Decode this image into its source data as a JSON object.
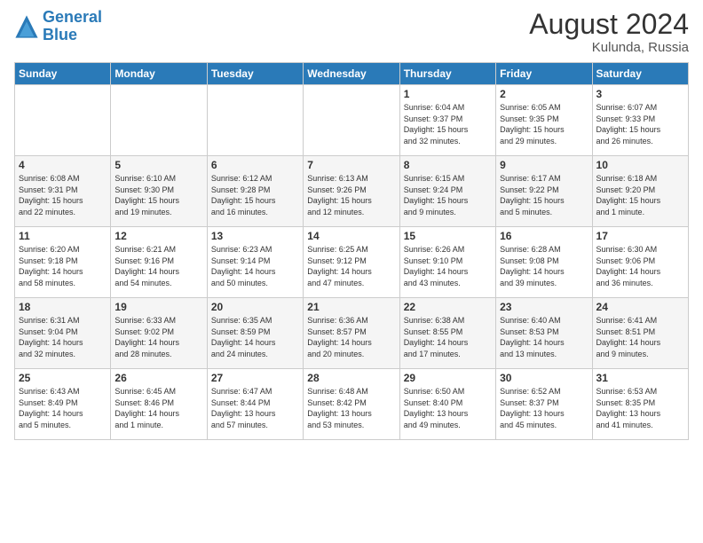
{
  "logo": {
    "line1": "General",
    "line2": "Blue"
  },
  "title": "August 2024",
  "subtitle": "Kulunda, Russia",
  "days_header": [
    "Sunday",
    "Monday",
    "Tuesday",
    "Wednesday",
    "Thursday",
    "Friday",
    "Saturday"
  ],
  "weeks": [
    [
      {
        "day": "",
        "info": ""
      },
      {
        "day": "",
        "info": ""
      },
      {
        "day": "",
        "info": ""
      },
      {
        "day": "",
        "info": ""
      },
      {
        "day": "1",
        "info": "Sunrise: 6:04 AM\nSunset: 9:37 PM\nDaylight: 15 hours\nand 32 minutes."
      },
      {
        "day": "2",
        "info": "Sunrise: 6:05 AM\nSunset: 9:35 PM\nDaylight: 15 hours\nand 29 minutes."
      },
      {
        "day": "3",
        "info": "Sunrise: 6:07 AM\nSunset: 9:33 PM\nDaylight: 15 hours\nand 26 minutes."
      }
    ],
    [
      {
        "day": "4",
        "info": "Sunrise: 6:08 AM\nSunset: 9:31 PM\nDaylight: 15 hours\nand 22 minutes."
      },
      {
        "day": "5",
        "info": "Sunrise: 6:10 AM\nSunset: 9:30 PM\nDaylight: 15 hours\nand 19 minutes."
      },
      {
        "day": "6",
        "info": "Sunrise: 6:12 AM\nSunset: 9:28 PM\nDaylight: 15 hours\nand 16 minutes."
      },
      {
        "day": "7",
        "info": "Sunrise: 6:13 AM\nSunset: 9:26 PM\nDaylight: 15 hours\nand 12 minutes."
      },
      {
        "day": "8",
        "info": "Sunrise: 6:15 AM\nSunset: 9:24 PM\nDaylight: 15 hours\nand 9 minutes."
      },
      {
        "day": "9",
        "info": "Sunrise: 6:17 AM\nSunset: 9:22 PM\nDaylight: 15 hours\nand 5 minutes."
      },
      {
        "day": "10",
        "info": "Sunrise: 6:18 AM\nSunset: 9:20 PM\nDaylight: 15 hours\nand 1 minute."
      }
    ],
    [
      {
        "day": "11",
        "info": "Sunrise: 6:20 AM\nSunset: 9:18 PM\nDaylight: 14 hours\nand 58 minutes."
      },
      {
        "day": "12",
        "info": "Sunrise: 6:21 AM\nSunset: 9:16 PM\nDaylight: 14 hours\nand 54 minutes."
      },
      {
        "day": "13",
        "info": "Sunrise: 6:23 AM\nSunset: 9:14 PM\nDaylight: 14 hours\nand 50 minutes."
      },
      {
        "day": "14",
        "info": "Sunrise: 6:25 AM\nSunset: 9:12 PM\nDaylight: 14 hours\nand 47 minutes."
      },
      {
        "day": "15",
        "info": "Sunrise: 6:26 AM\nSunset: 9:10 PM\nDaylight: 14 hours\nand 43 minutes."
      },
      {
        "day": "16",
        "info": "Sunrise: 6:28 AM\nSunset: 9:08 PM\nDaylight: 14 hours\nand 39 minutes."
      },
      {
        "day": "17",
        "info": "Sunrise: 6:30 AM\nSunset: 9:06 PM\nDaylight: 14 hours\nand 36 minutes."
      }
    ],
    [
      {
        "day": "18",
        "info": "Sunrise: 6:31 AM\nSunset: 9:04 PM\nDaylight: 14 hours\nand 32 minutes."
      },
      {
        "day": "19",
        "info": "Sunrise: 6:33 AM\nSunset: 9:02 PM\nDaylight: 14 hours\nand 28 minutes."
      },
      {
        "day": "20",
        "info": "Sunrise: 6:35 AM\nSunset: 8:59 PM\nDaylight: 14 hours\nand 24 minutes."
      },
      {
        "day": "21",
        "info": "Sunrise: 6:36 AM\nSunset: 8:57 PM\nDaylight: 14 hours\nand 20 minutes."
      },
      {
        "day": "22",
        "info": "Sunrise: 6:38 AM\nSunset: 8:55 PM\nDaylight: 14 hours\nand 17 minutes."
      },
      {
        "day": "23",
        "info": "Sunrise: 6:40 AM\nSunset: 8:53 PM\nDaylight: 14 hours\nand 13 minutes."
      },
      {
        "day": "24",
        "info": "Sunrise: 6:41 AM\nSunset: 8:51 PM\nDaylight: 14 hours\nand 9 minutes."
      }
    ],
    [
      {
        "day": "25",
        "info": "Sunrise: 6:43 AM\nSunset: 8:49 PM\nDaylight: 14 hours\nand 5 minutes."
      },
      {
        "day": "26",
        "info": "Sunrise: 6:45 AM\nSunset: 8:46 PM\nDaylight: 14 hours\nand 1 minute."
      },
      {
        "day": "27",
        "info": "Sunrise: 6:47 AM\nSunset: 8:44 PM\nDaylight: 13 hours\nand 57 minutes."
      },
      {
        "day": "28",
        "info": "Sunrise: 6:48 AM\nSunset: 8:42 PM\nDaylight: 13 hours\nand 53 minutes."
      },
      {
        "day": "29",
        "info": "Sunrise: 6:50 AM\nSunset: 8:40 PM\nDaylight: 13 hours\nand 49 minutes."
      },
      {
        "day": "30",
        "info": "Sunrise: 6:52 AM\nSunset: 8:37 PM\nDaylight: 13 hours\nand 45 minutes."
      },
      {
        "day": "31",
        "info": "Sunrise: 6:53 AM\nSunset: 8:35 PM\nDaylight: 13 hours\nand 41 minutes."
      }
    ]
  ]
}
